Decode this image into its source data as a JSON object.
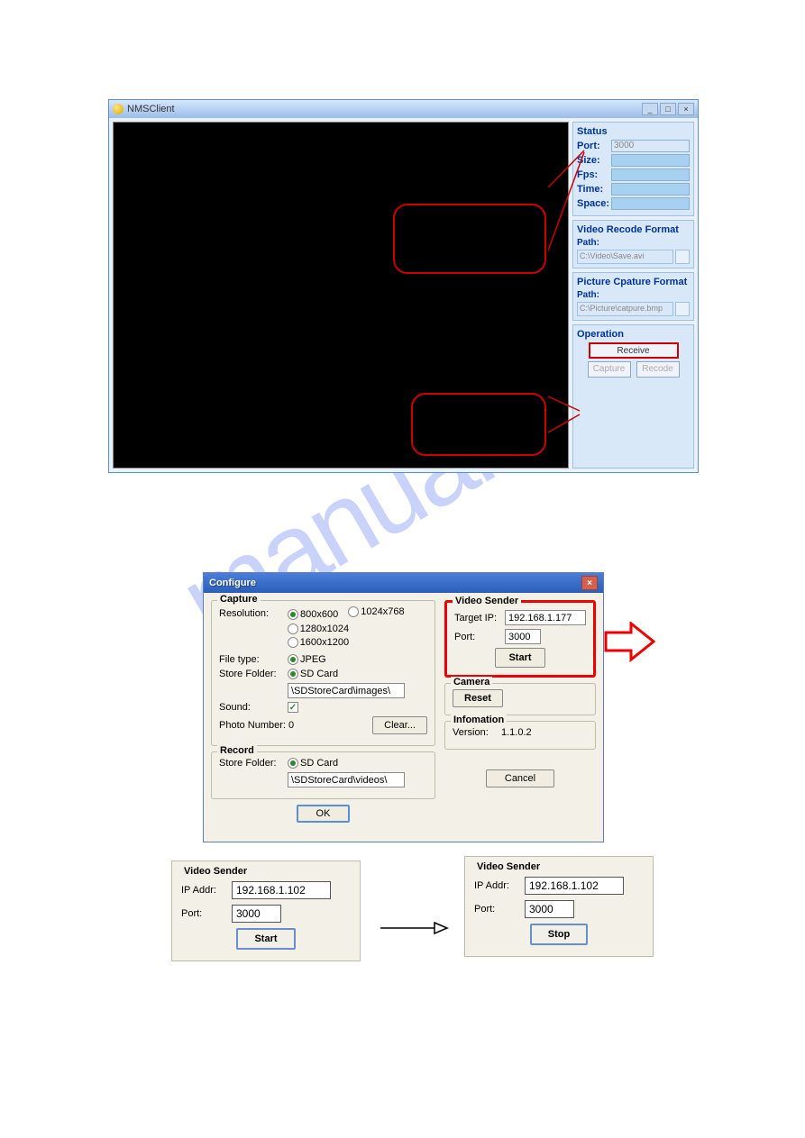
{
  "nms": {
    "title": "NMSClient",
    "status": {
      "heading": "Status",
      "port_label": "Port:",
      "port_value": "3000",
      "size_label": "Size:",
      "fps_label": "Fps:",
      "time_label": "Time:",
      "space_label": "Space:"
    },
    "recode": {
      "heading": "Video Recode Format",
      "path_label": "Path:",
      "path_value": "C:\\Video\\Save.avi"
    },
    "capture": {
      "heading": "Picture Cpature Format",
      "path_label": "Path:",
      "path_value": "C:\\Picture\\catpure.bmp"
    },
    "operation": {
      "heading": "Operation",
      "receive": "Receive",
      "capture": "Capture",
      "recode": "Recode"
    }
  },
  "configure": {
    "title": "Configure",
    "capture": {
      "heading": "Capture",
      "resolution_label": "Resolution:",
      "res_800": "800x600",
      "res_1024": "1024x768",
      "res_1280": "1280x1024",
      "res_1600": "1600x1200",
      "filetype_label": "File type:",
      "filetype_jpeg": "JPEG",
      "store_label": "Store Folder:",
      "store_sd": "SD Card",
      "store_path": "\\SDStoreCard\\images\\",
      "sound_label": "Sound:",
      "photo_num_label": "Photo Number: 0",
      "clear": "Clear..."
    },
    "record": {
      "heading": "Record",
      "store_label": "Store Folder:",
      "store_sd": "SD Card",
      "store_path": "\\SDStoreCard\\videos\\"
    },
    "video_sender": {
      "heading": "Video Sender",
      "target_ip_label": "Target IP:",
      "target_ip": "192.168.1.177",
      "port_label": "Port:",
      "port": "3000",
      "start": "Start"
    },
    "camera": {
      "heading": "Camera",
      "reset": "Reset"
    },
    "information": {
      "heading": "Infomation",
      "version_label": "Version:",
      "version": "1.1.0.2"
    },
    "ok": "OK",
    "cancel": "Cancel"
  },
  "vs_start": {
    "heading": "Video Sender",
    "ip_label": "IP Addr:",
    "ip": "192.168.1.102",
    "port_label": "Port:",
    "port": "3000",
    "button": "Start"
  },
  "vs_stop": {
    "heading": "Video Sender",
    "ip_label": "IP Addr:",
    "ip": "192.168.1.102",
    "port_label": "Port:",
    "port": "3000",
    "button": "Stop"
  },
  "watermark": "manualshive"
}
